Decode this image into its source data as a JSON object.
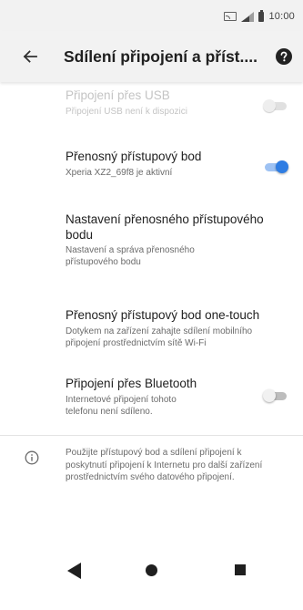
{
  "status_bar": {
    "time": "10:00",
    "icons": [
      "cast-icon",
      "signal-icon",
      "battery-icon"
    ]
  },
  "app_bar": {
    "title": "Sdílení připojení a příst....",
    "back_icon": "arrow-back-icon",
    "help_icon": "help-icon"
  },
  "settings": [
    {
      "title": "Připojení přes USB",
      "subtitle": "Připojení USB není k dispozici",
      "toggle": "off",
      "enabled": false
    },
    {
      "title": "Přenosný přístupový bod",
      "subtitle": "Xperia XZ2_69f8 je aktivní",
      "toggle": "on",
      "enabled": true
    },
    {
      "title": "Nastavení přenosného přístupového bodu",
      "subtitle": "Nastavení a správa přenosného přístupového bodu",
      "enabled": true
    },
    {
      "title": "Přenosný přístupový bod one-touch",
      "subtitle": "Dotykem na zařízení zahajte sdílení mobilního připojení prostřednictvím sítě Wi-Fi",
      "enabled": true
    },
    {
      "title": "Připojení přes Bluetooth",
      "subtitle": "Internetové připojení tohoto telefonu není sdíleno.",
      "toggle": "off",
      "enabled": true
    }
  ],
  "info": {
    "icon": "info-icon",
    "text": "Použijte přístupový bod a sdílení připojení k poskytnutí připojení k Internetu pro další zařízení prostřednictvím svého datového připojení."
  },
  "nav_bar": {
    "icons": [
      "back-triangle-icon",
      "home-circle-icon",
      "recents-square-icon"
    ]
  },
  "colors": {
    "accent": "#2f7de3",
    "accent_track": "#9ec2f3",
    "app_bar_bg": "#f2f2f2",
    "secondary_text": "#6b6b6b",
    "disabled_text": "#c4c4c4"
  }
}
